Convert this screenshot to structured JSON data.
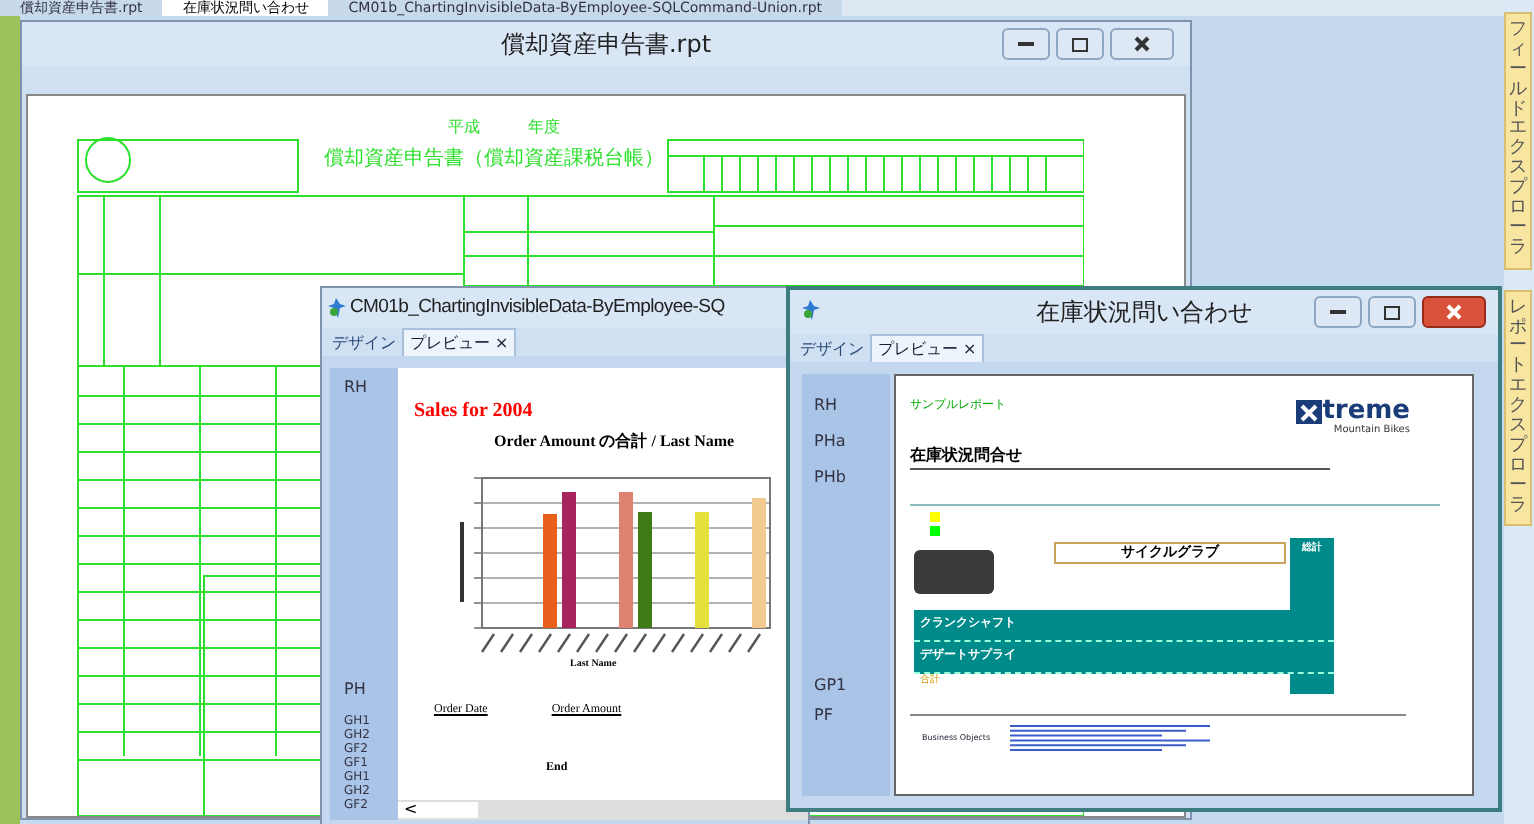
{
  "doc_tabs": [
    {
      "label": "償却資産申告書.rpt",
      "selected": false
    },
    {
      "label": "在庫状況問い合わせ",
      "selected": true
    },
    {
      "label": "CM01b_ChartingInvisibleData-ByEmployee-SQLCommand-Union.rpt",
      "selected": false
    }
  ],
  "side_panels": [
    "フィールドエクスプローラ",
    "レポートエクスプローラ"
  ],
  "form_window": {
    "title": "償却資産申告書.rpt",
    "era": "平成",
    "year_label": "年度",
    "heading": "償却資産申告書（償却資産課税台帳）"
  },
  "chart_window": {
    "title": "CM01b_ChartingInvisibleData-ByEmployee-SQ",
    "tabs": [
      {
        "label": "デザイン",
        "selected": false
      },
      {
        "label": "プレビュー ×",
        "selected": true
      }
    ],
    "top_sections": [
      "RH"
    ],
    "bottom_sections": [
      "PH",
      "GH1",
      "GH2",
      "GF2",
      "GF1",
      "GH1",
      "GH2",
      "GF2"
    ],
    "report_title": "Sales for 2004",
    "chart_title": "Order Amount の合計 / Last Name",
    "axis_label": "Last Name",
    "columns": [
      "Order Date",
      "Order Amount"
    ],
    "end_text": "End",
    "scroll_arrow": "<"
  },
  "inventory_window": {
    "title": "在庫状況問い合わせ",
    "tabs": [
      {
        "label": "デザイン",
        "selected": false
      },
      {
        "label": "プレビュー ×",
        "selected": true
      }
    ],
    "sections": [
      {
        "label": "RH",
        "kind": "top"
      },
      {
        "label": "PHa",
        "kind": "top"
      },
      {
        "label": "PHb",
        "kind": "top"
      },
      {
        "label": "GP1",
        "kind": "bottom"
      },
      {
        "label": "PF",
        "kind": "bottom"
      }
    ],
    "sample_label": "サンプルレポート",
    "logo": "treme",
    "logo_sub": "Mountain Bikes",
    "heading": "在庫状況問合せ",
    "legend": [
      {
        "color": "#ffff00"
      },
      {
        "color": "#00ff00"
      }
    ],
    "product": "サイクルグラブ",
    "total_header": "総計",
    "rows": [
      {
        "label": "クランクシャフト"
      },
      {
        "label": "デザートサプライ"
      }
    ],
    "total_label": "合計",
    "footer_logo": "Business Objects"
  }
}
